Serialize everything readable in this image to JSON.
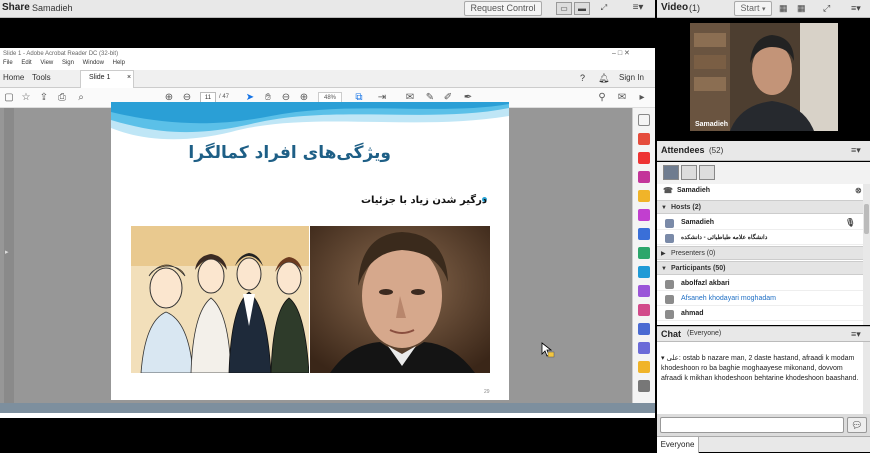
{
  "share": {
    "title": "Share",
    "presenter": "Samadieh",
    "request_control": "Request Control"
  },
  "acrobat": {
    "window_title": "Slide 1 - Adobe Acrobat Reader DC (32-bit)",
    "menu": [
      "File",
      "Edit",
      "View",
      "Sign",
      "Window",
      "Help"
    ],
    "tabs": {
      "home": "Home",
      "tools": "Tools",
      "doc": "Slide 1",
      "sign_in": "Sign In"
    },
    "page_current": "11",
    "page_total": "/ 47",
    "zoom": "48%"
  },
  "slide": {
    "title": "ویژگی‌های افراد کمالگرا",
    "bullet": "درگیر شدن زیاد با جزئیات",
    "page_number": "29"
  },
  "video": {
    "title": "Video",
    "count": "(1)",
    "start": "Start",
    "camera_name": "Samadieh"
  },
  "attendees": {
    "title": "Attendees",
    "count": "(52)",
    "me": "Samadieh",
    "hosts_label": "Hosts (2)",
    "hosts": [
      "Samadieh",
      "دانشگاه علامه طباطبائی - دانشکده"
    ],
    "presenters_label": "Presenters (0)",
    "participants_label": "Participants (50)",
    "participants": [
      "abolfazl akbari",
      "Afsaneh khodayari moghadam",
      "ahmad"
    ]
  },
  "chat": {
    "title": "Chat",
    "scope": "(Everyone)",
    "message": "▾ علی: ostab b nazare man, 2 daste hastand, afraadi k modam khodeshoon ro ba baghie moghaayese mikonand, dovvom afraadi k mikhan khodeshoon behtarine khodeshoon baashand.",
    "footer_tab": "Everyone"
  },
  "colors": {
    "slide_title": "#1e5f86",
    "accent": "#2aa3d4",
    "link": "#1f6fc4"
  }
}
